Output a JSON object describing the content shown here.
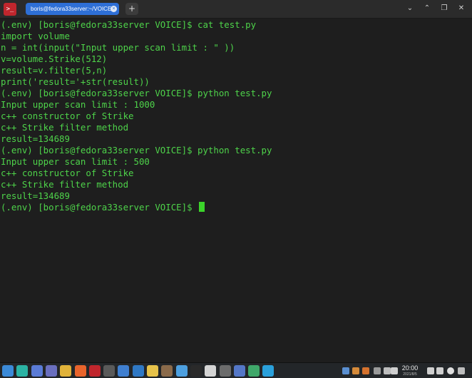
{
  "window": {
    "tab_title": "boris@fedora33server:~/VOICE",
    "new_tab_label": "+",
    "minimize_glyph": "⌄",
    "maximize_glyph": "⌃",
    "restore_glyph": "❐",
    "close_glyph": "✕"
  },
  "terminal": {
    "lines": [
      "(.env) [boris@fedora33server VOICE]$ cat test.py",
      "import volume",
      "n = int(input(\"Input upper scan limit : \" ))",
      "v=volume.Strike(512)",
      "result=v.filter(5,n)",
      "print('result='+str(result))",
      "(.env) [boris@fedora33server VOICE]$ python test.py",
      "Input upper scan limit : 1000",
      "c++ constructor of Strike",
      "c++ Strike filter method",
      "result=134689",
      "(.env) [boris@fedora33server VOICE]$ python test.py",
      "Input upper scan limit : 500",
      "c++ constructor of Strike",
      "c++ Strike filter method",
      "result=134689"
    ],
    "prompt": "(.env) [boris@fedora33server VOICE]$ ",
    "text_color": "#4ed34a",
    "background": "#1e1e1e"
  },
  "taskbar": {
    "time": "20:00",
    "date": "2021/8/5",
    "icons": [
      {
        "name": "app-launcher-icon",
        "color": "#3b8ad8"
      },
      {
        "name": "file-manager-icon",
        "color": "#2bb3a4"
      },
      {
        "name": "desktop-icon",
        "color": "#5a7bd6"
      },
      {
        "name": "settings-icon",
        "color": "#6a6fbf"
      },
      {
        "name": "chrome-icon",
        "color": "#e0b23a"
      },
      {
        "name": "firefox-icon",
        "color": "#e8642c"
      },
      {
        "name": "terminal-icon",
        "color": "#c0262d"
      },
      {
        "name": "vim-icon",
        "color": "#5a5a5a"
      },
      {
        "name": "network-icon",
        "color": "#3f7fd0"
      },
      {
        "name": "qbittorrent-icon",
        "color": "#2f78c4"
      },
      {
        "name": "notes-icon",
        "color": "#e6c24a"
      },
      {
        "name": "owl-icon",
        "color": "#8a6a4a"
      },
      {
        "name": "grid-app-icon",
        "color": "#4da0e0"
      },
      {
        "name": "jetbrains-icon",
        "color": "#2a2a2a"
      },
      {
        "name": "record-icon",
        "color": "#d4d4d4"
      },
      {
        "name": "sound-icon",
        "color": "#6c6c6c"
      },
      {
        "name": "image-viewer-icon",
        "color": "#5477c7"
      },
      {
        "name": "pycharm-icon",
        "color": "#3fa86a"
      },
      {
        "name": "telegram-icon",
        "color": "#2aa0db"
      }
    ],
    "tray_icons": [
      {
        "name": "wave-tray-icon",
        "color": "#5a8fd0"
      },
      {
        "name": "package-tray-icon",
        "color": "#d58a3a"
      },
      {
        "name": "updates-tray-icon",
        "color": "#d5722e"
      },
      {
        "name": "clipboard-tray-icon",
        "color": "#9a9a9a"
      },
      {
        "name": "pen-tray-icon",
        "color": "#bdbdbd"
      },
      {
        "name": "menu-tray-icon",
        "color": "#cfcfcf"
      },
      {
        "name": "eject-tray-icon",
        "color": "#cfcfcf"
      },
      {
        "name": "volume-tray-icon",
        "color": "#cfcfcf"
      },
      {
        "name": "power-tray-icon",
        "color": "#e0e0e0"
      },
      {
        "name": "desktop-tray-icon",
        "color": "#bdbdbd"
      }
    ]
  }
}
